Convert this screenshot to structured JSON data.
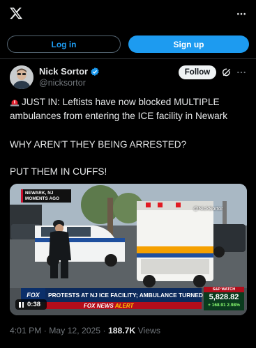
{
  "header": {
    "logo_icon": "x-logo-icon",
    "more_icon": "more-icon"
  },
  "auth": {
    "login_label": "Log in",
    "signup_label": "Sign up"
  },
  "post": {
    "author": {
      "name": "Nick Sortor",
      "handle": "@nicksortor",
      "verified_icon": "verified-badge-icon"
    },
    "follow_label": "Follow",
    "grok_icon": "grok-icon",
    "more_icon": "more-icon",
    "text": {
      "line1": "JUST IN: Leftists have now blocked MULTIPLE",
      "line2": "ambulances from entering the ICE facility in Newark",
      "line3": "WHY AREN'T THEY BEING ARRESTED?",
      "line4": "PUT THEM IN CUFFS!",
      "leading_icon": "rotating-light-icon"
    },
    "video": {
      "corner_tag_line1": "NEWARK, NJ",
      "corner_tag_line2": "MOMENTS AGO",
      "watermark": "@NickSortor",
      "network_logo": "FOX",
      "headline": "PROTESTS AT NJ ICE FACILITY; AMBULANCE TURNED AWAY",
      "alert_prefix": "FOX NEWS",
      "alert_word": "ALERT",
      "ticker_label": "S&P WATCH",
      "ticker_value": "5,828.82",
      "ticker_change": "+ 168.91  2.98%",
      "duration": "0:38",
      "pause_icon": "pause-icon"
    },
    "meta": {
      "time": "4:01 PM",
      "separator": "·",
      "date": "May 12, 2025",
      "views": "188.7K",
      "views_label": "Views"
    }
  },
  "colors": {
    "background": "#000000",
    "accent": "#1d9bf0",
    "text": "#e7e9ea",
    "muted": "#71767b"
  }
}
